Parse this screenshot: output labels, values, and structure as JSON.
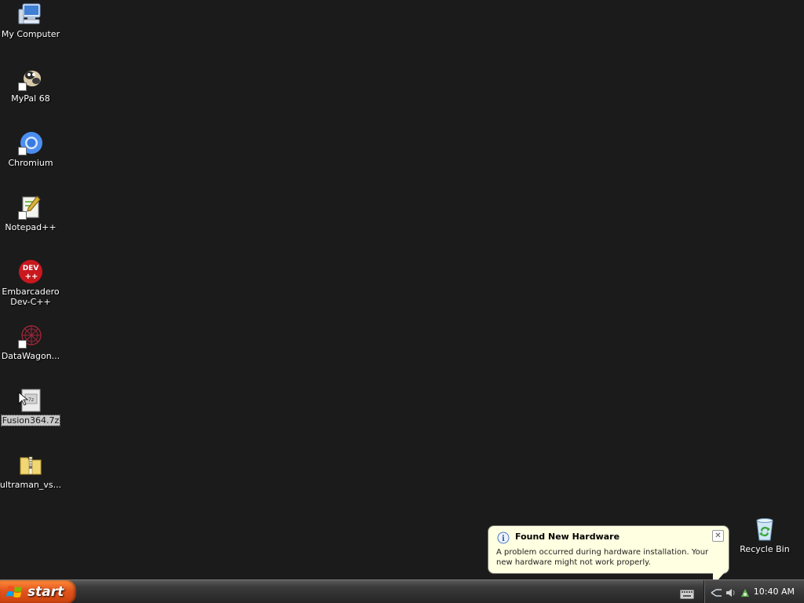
{
  "desktop": {
    "icons": [
      {
        "label": "My Computer"
      },
      {
        "label": "MyPal 68"
      },
      {
        "label": "Chromium"
      },
      {
        "label": "Notepad++"
      },
      {
        "label": "Embarcadero\nDev-C++"
      },
      {
        "label": "DataWagon..."
      },
      {
        "label": "Fusion364.7z"
      },
      {
        "label": "ultraman_vs..."
      },
      {
        "label": "Recycle Bin"
      }
    ],
    "selected_icon": "Fusion364.7z"
  },
  "balloon": {
    "title": "Found New Hardware",
    "message": "A problem occurred during hardware installation. Your new hardware might not work properly.",
    "close_label": "✕"
  },
  "taskbar": {
    "start_label": "start",
    "clock": "10:40 AM"
  },
  "colors": {
    "desktop_bg": "#1b1b1b",
    "balloon_bg": "#ffffe1",
    "start_orange": "#e2541b"
  }
}
